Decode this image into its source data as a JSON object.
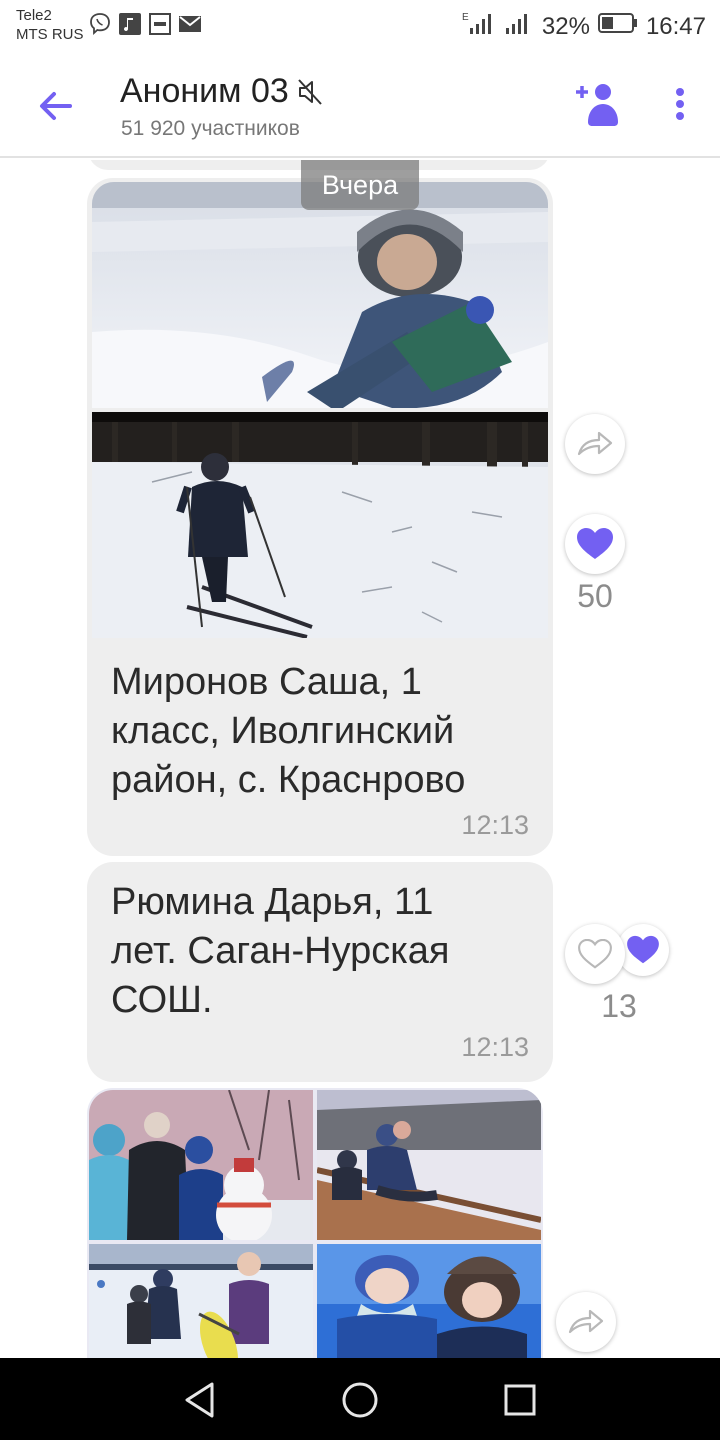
{
  "status_bar": {
    "carrier_line1": "Tele2",
    "carrier_line2": "MTS RUS",
    "battery_percent": "32%",
    "time": "16:47",
    "left_icons": [
      "viber-icon",
      "music-icon",
      "sim-icon",
      "mail-icon"
    ]
  },
  "header": {
    "title": "Аноним 03",
    "subtitle": "51 920 участников",
    "accent_color": "#7360f2",
    "muted": true
  },
  "chat": {
    "date_separator": "Вчера",
    "messages": [
      {
        "type": "photos",
        "photos": [
          "boy-in-snow-photo",
          "boy-skiing-photo"
        ],
        "text_lines": [
          "Миронов Саша, 1",
          "класс, Иволгинский",
          "район, с. Краснрово"
        ],
        "time": "12:13",
        "likes": "50",
        "liked": true
      },
      {
        "type": "text",
        "text_lines": [
          "Рюмина Дарья, 11",
          "лет. Саган-Нурская",
          "СОШ."
        ],
        "time": "12:13",
        "likes": "13",
        "liked": false
      },
      {
        "type": "photo-grid",
        "photos": [
          "snowman-kids-photo",
          "sledding-kids-photo",
          "kids-with-tubes-photo",
          "kids-winter-portrait-photo"
        ]
      }
    ]
  },
  "colors": {
    "accent": "#7360f2",
    "bubble": "#eeeeee",
    "time_text": "#9a9a9a"
  }
}
